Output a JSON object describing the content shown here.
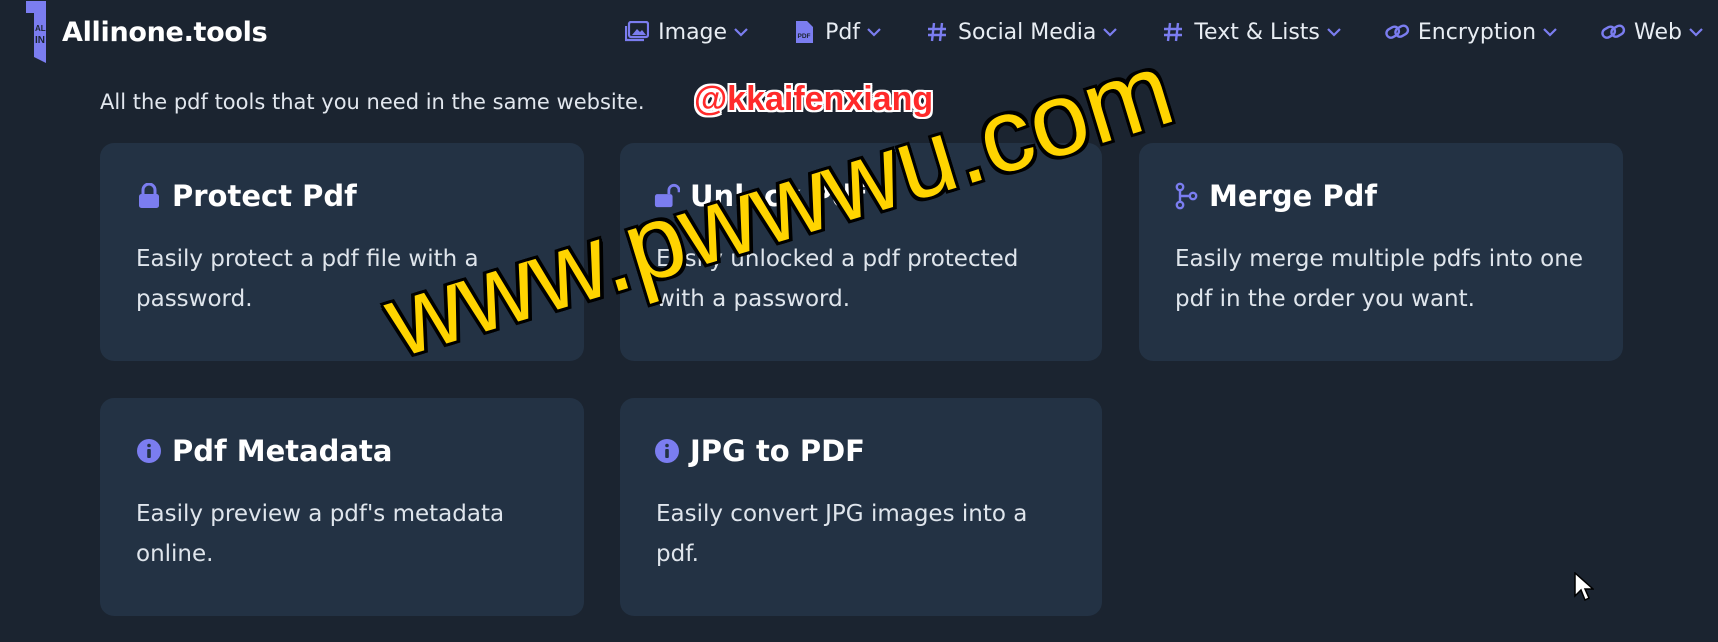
{
  "app": {
    "logo_text": "Allinone.tools",
    "logo_mark_text": "ALL IN"
  },
  "nav": [
    {
      "label": "Image",
      "icon": "image-icon"
    },
    {
      "label": "Pdf",
      "icon": "pdf-file-icon"
    },
    {
      "label": "Social Media",
      "icon": "hash-icon"
    },
    {
      "label": "Text & Lists",
      "icon": "hash-icon"
    },
    {
      "label": "Encryption",
      "icon": "link-icon"
    },
    {
      "label": "Web",
      "icon": "link-icon"
    }
  ],
  "intro": "All the pdf tools that you need in the same website.",
  "cards": [
    {
      "title": "Protect Pdf",
      "icon": "lock-icon",
      "description": "Easily protect a pdf file with a password."
    },
    {
      "title": "Unlock Pdf",
      "icon": "unlock-icon",
      "description": "Easily unlocked a pdf protected with a password."
    },
    {
      "title": "Merge Pdf",
      "icon": "merge-icon",
      "description": "Easily merge multiple pdfs into one pdf in the order you want."
    },
    {
      "title": "Pdf Metadata",
      "icon": "info-icon",
      "description": "Easily preview a pdf's metadata online."
    },
    {
      "title": "JPG to PDF",
      "icon": "info-icon",
      "description": "Easily convert JPG images into a pdf."
    }
  ],
  "watermarks": {
    "handle": "@kkaifenxiang",
    "site": "www.pwwwu.com"
  },
  "colors": {
    "background": "#1b2430",
    "card": "#233244",
    "accent": "#7b7df0"
  }
}
